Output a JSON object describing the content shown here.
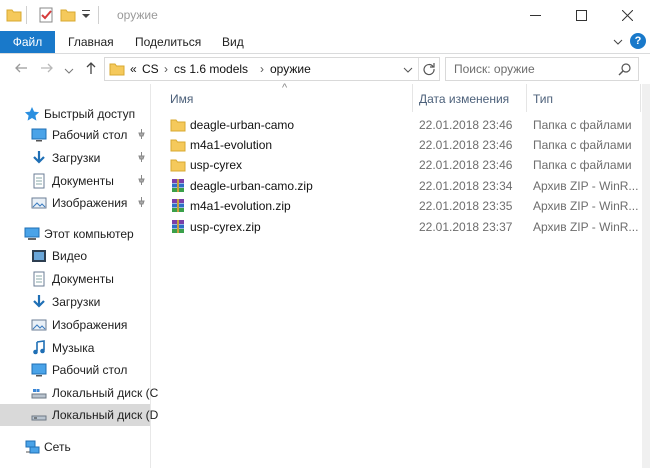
{
  "window": {
    "title": "оружие",
    "minimize_glyph": "—",
    "maximize_glyph": "☐",
    "close_glyph": "✕"
  },
  "ribbon": {
    "tabs": [
      {
        "label": "Файл"
      },
      {
        "label": "Главная"
      },
      {
        "label": "Поделиться"
      },
      {
        "label": "Вид"
      }
    ],
    "expand_glyph": "⌄",
    "help_glyph": "?"
  },
  "nav": {
    "back_glyph": "←",
    "forward_glyph": "→",
    "dropdown_glyph": "⌄",
    "up_glyph": "↑",
    "overflow_glyph": "«",
    "separator_glyph": "›",
    "breadcrumbs": [
      "CS",
      "cs 1.6 models",
      "оружие"
    ],
    "search_placeholder": "Поиск: оружие"
  },
  "sidebar": {
    "quick_access": {
      "label": "Быстрый доступ"
    },
    "quick_items": [
      {
        "label": "Рабочий стол",
        "icon": "desktop-icon"
      },
      {
        "label": "Загрузки",
        "icon": "download-icon"
      },
      {
        "label": "Документы",
        "icon": "documents-icon"
      },
      {
        "label": "Изображения",
        "icon": "pictures-icon"
      }
    ],
    "this_pc": {
      "label": "Этот компьютер"
    },
    "pc_items": [
      {
        "label": "Видео",
        "icon": "video-icon"
      },
      {
        "label": "Документы",
        "icon": "documents-icon"
      },
      {
        "label": "Загрузки",
        "icon": "download-icon"
      },
      {
        "label": "Изображения",
        "icon": "pictures-icon"
      },
      {
        "label": "Музыка",
        "icon": "music-icon"
      },
      {
        "label": "Рабочий стол",
        "icon": "desktop-icon"
      },
      {
        "label": "Локальный диск (C",
        "icon": "drive-c-icon"
      },
      {
        "label": "Локальный диск (D",
        "icon": "drive-d-icon"
      }
    ],
    "network": {
      "label": "Сеть"
    }
  },
  "columns": {
    "name": "Имя",
    "date": "Дата изменения",
    "type": "Тип",
    "sort_glyph": "^"
  },
  "files": [
    {
      "name": "deagle-urban-camo",
      "date": "22.01.2018 23:46",
      "type": "Папка с файлами",
      "icon": "folder-icon"
    },
    {
      "name": "m4a1-evolution",
      "date": "22.01.2018 23:46",
      "type": "Папка с файлами",
      "icon": "folder-icon"
    },
    {
      "name": "usp-cyrex",
      "date": "22.01.2018 23:46",
      "type": "Папка с файлами",
      "icon": "folder-icon"
    },
    {
      "name": "deagle-urban-camo.zip",
      "date": "22.01.2018 23:34",
      "type": "Архив ZIP - WinR...",
      "icon": "winrar-archive-icon"
    },
    {
      "name": "m4a1-evolution.zip",
      "date": "22.01.2018 23:35",
      "type": "Архив ZIP - WinR...",
      "icon": "winrar-archive-icon"
    },
    {
      "name": "usp-cyrex.zip",
      "date": "22.01.2018 23:37",
      "type": "Архив ZIP - WinR...",
      "icon": "winrar-archive-icon"
    }
  ],
  "colors": {
    "accent": "#1979ca",
    "folder": "#f5c95b",
    "selected_bg": "#d9d9d9"
  }
}
